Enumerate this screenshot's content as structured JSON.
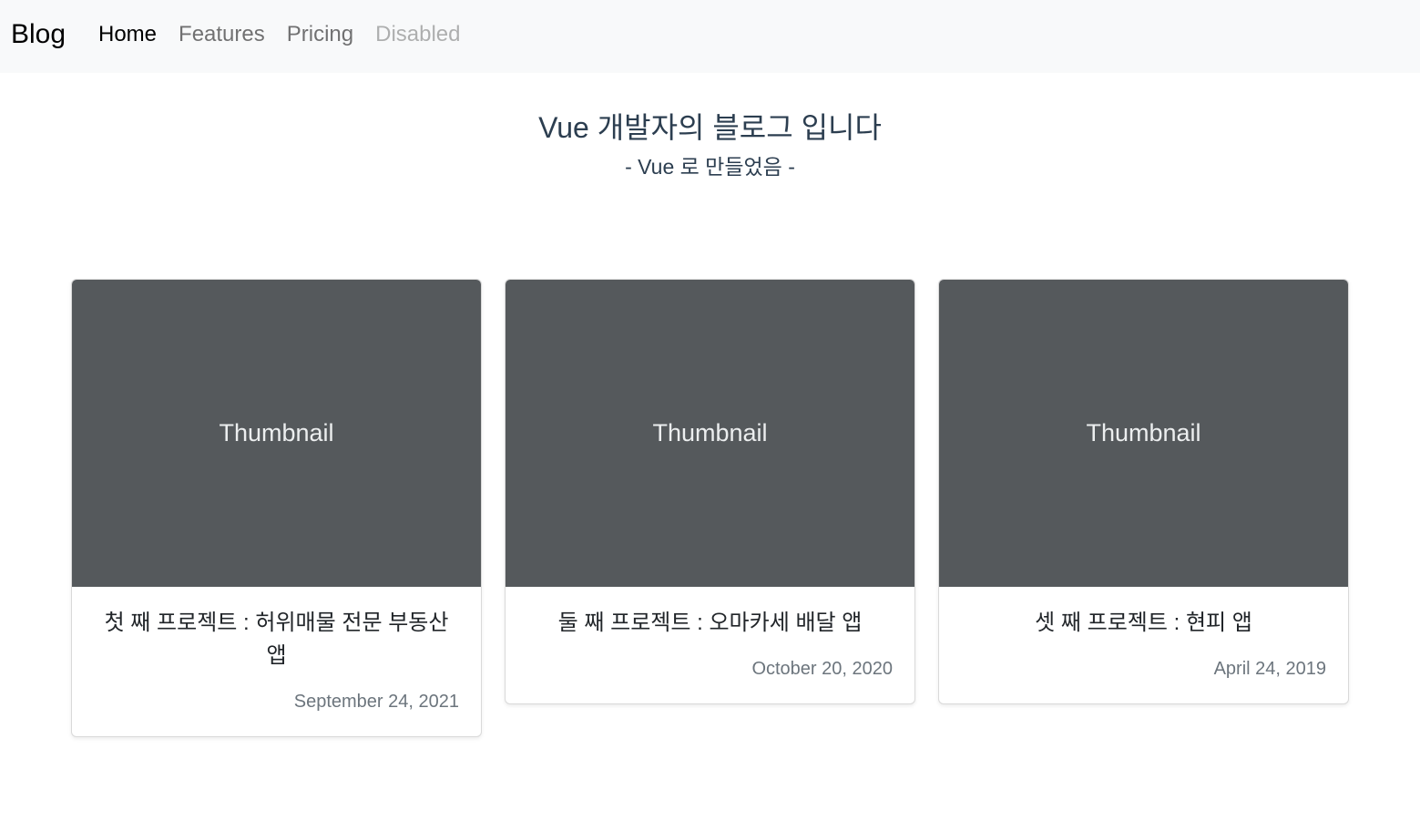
{
  "navbar": {
    "brand": "Blog",
    "links": [
      {
        "label": "Home",
        "state": "active"
      },
      {
        "label": "Features",
        "state": "normal"
      },
      {
        "label": "Pricing",
        "state": "normal"
      },
      {
        "label": "Disabled",
        "state": "disabled"
      }
    ]
  },
  "hero": {
    "title": "Vue 개발자의 블로그 입니다",
    "subtitle": "- Vue 로 만들었음 -"
  },
  "cards": [
    {
      "thumbnail": "Thumbnail",
      "title": "첫 째 프로젝트 : 허위매물 전문 부동산 앱",
      "date": "September 24, 2021"
    },
    {
      "thumbnail": "Thumbnail",
      "title": "둘 째 프로젝트 : 오마카세 배달 앱",
      "date": "October 20, 2020"
    },
    {
      "thumbnail": "Thumbnail",
      "title": "셋 째 프로젝트 : 현피 앱",
      "date": "April 24, 2019"
    }
  ],
  "colors": {
    "navbar_bg": "#f8f9fa",
    "thumbnail_bg": "#55595c",
    "heading_text": "#2c3e50",
    "date_text": "#6c757d"
  }
}
